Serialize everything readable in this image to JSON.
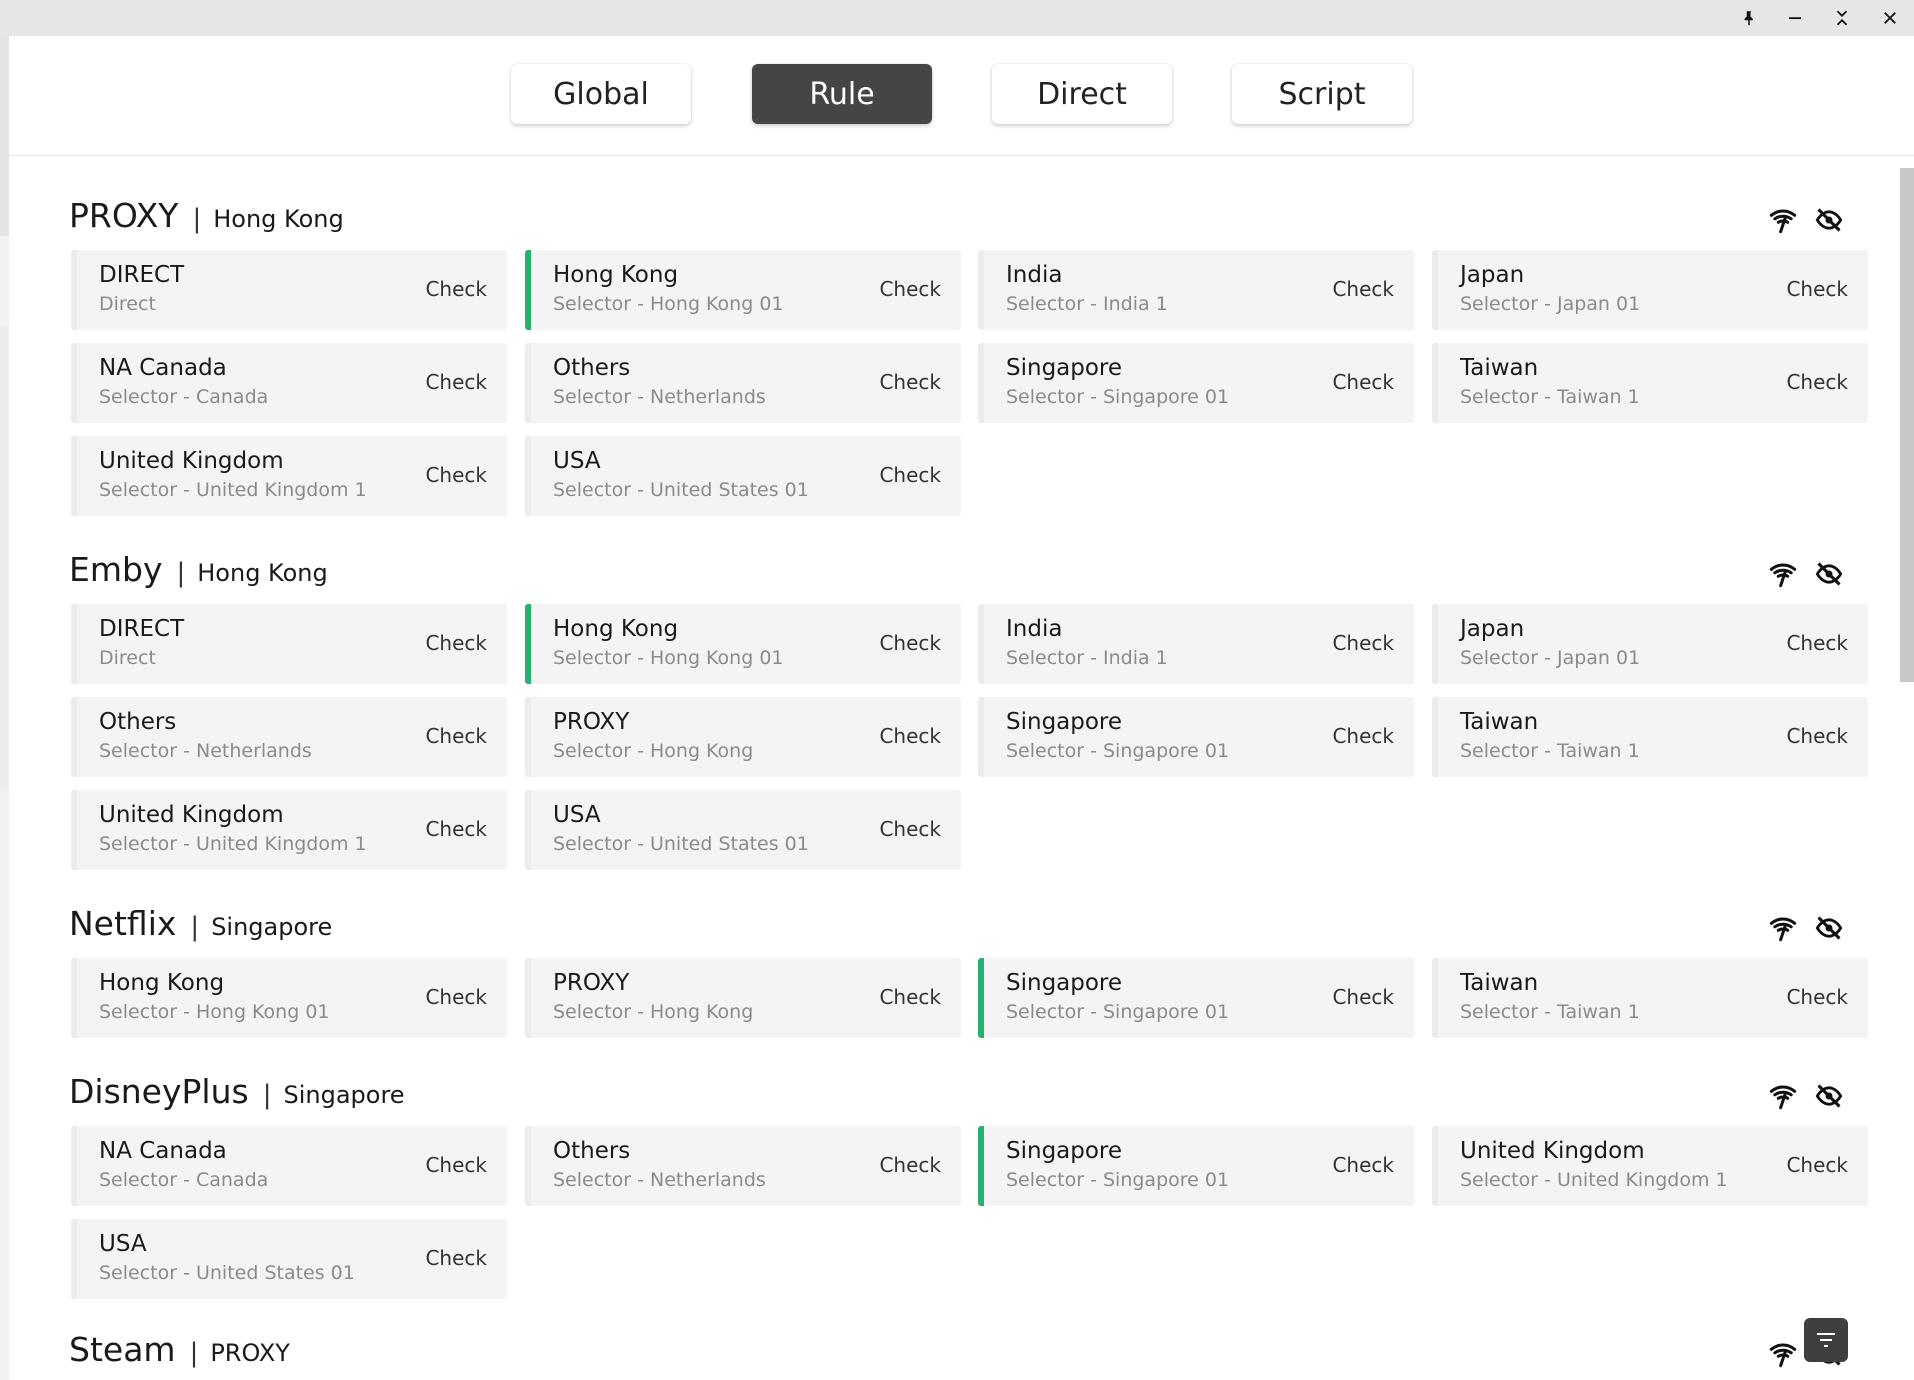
{
  "modes": [
    "Global",
    "Rule",
    "Direct",
    "Script"
  ],
  "active_mode": "Rule",
  "window_controls": [
    "pin-icon",
    "minimize-icon",
    "collapse-icon",
    "close-icon"
  ],
  "accent_color": "#27b06e",
  "check_label": "Check",
  "groups": [
    {
      "name": "PROXY",
      "now": "Hong Kong",
      "proxies": [
        {
          "name": "DIRECT",
          "sub": "Direct",
          "selected": false
        },
        {
          "name": "Hong Kong",
          "sub": "Selector - Hong Kong 01",
          "selected": true
        },
        {
          "name": "India",
          "sub": "Selector - India 1",
          "selected": false
        },
        {
          "name": "Japan",
          "sub": "Selector - Japan 01",
          "selected": false
        },
        {
          "name": "NA Canada",
          "sub": "Selector - Canada",
          "selected": false
        },
        {
          "name": "Others",
          "sub": "Selector - Netherlands",
          "selected": false
        },
        {
          "name": "Singapore",
          "sub": "Selector - Singapore 01",
          "selected": false
        },
        {
          "name": "Taiwan",
          "sub": "Selector - Taiwan 1",
          "selected": false
        },
        {
          "name": "United Kingdom",
          "sub": "Selector - United Kingdom 1",
          "selected": false
        },
        {
          "name": "USA",
          "sub": "Selector - United States 01",
          "selected": false
        }
      ]
    },
    {
      "name": "Emby",
      "now": "Hong Kong",
      "proxies": [
        {
          "name": "DIRECT",
          "sub": "Direct",
          "selected": false
        },
        {
          "name": "Hong Kong",
          "sub": "Selector - Hong Kong 01",
          "selected": true
        },
        {
          "name": "India",
          "sub": "Selector - India 1",
          "selected": false
        },
        {
          "name": "Japan",
          "sub": "Selector - Japan 01",
          "selected": false
        },
        {
          "name": "Others",
          "sub": "Selector - Netherlands",
          "selected": false
        },
        {
          "name": "PROXY",
          "sub": "Selector - Hong Kong",
          "selected": false
        },
        {
          "name": "Singapore",
          "sub": "Selector - Singapore 01",
          "selected": false
        },
        {
          "name": "Taiwan",
          "sub": "Selector - Taiwan 1",
          "selected": false
        },
        {
          "name": "United Kingdom",
          "sub": "Selector - United Kingdom 1",
          "selected": false
        },
        {
          "name": "USA",
          "sub": "Selector - United States 01",
          "selected": false
        }
      ]
    },
    {
      "name": "Netflix",
      "now": "Singapore",
      "proxies": [
        {
          "name": "Hong Kong",
          "sub": "Selector - Hong Kong 01",
          "selected": false
        },
        {
          "name": "PROXY",
          "sub": "Selector - Hong Kong",
          "selected": false
        },
        {
          "name": "Singapore",
          "sub": "Selector - Singapore 01",
          "selected": true
        },
        {
          "name": "Taiwan",
          "sub": "Selector - Taiwan 1",
          "selected": false
        }
      ]
    },
    {
      "name": "DisneyPlus",
      "now": "Singapore",
      "proxies": [
        {
          "name": "NA Canada",
          "sub": "Selector - Canada",
          "selected": false
        },
        {
          "name": "Others",
          "sub": "Selector - Netherlands",
          "selected": false
        },
        {
          "name": "Singapore",
          "sub": "Selector - Singapore 01",
          "selected": true
        },
        {
          "name": "United Kingdom",
          "sub": "Selector - United Kingdom 1",
          "selected": false
        },
        {
          "name": "USA",
          "sub": "Selector - United States 01",
          "selected": false
        }
      ]
    },
    {
      "name": "Steam",
      "now": "PROXY",
      "proxies": []
    }
  ],
  "group_actions": [
    "latency-test-icon",
    "hide-icon"
  ],
  "fab_icon": "filter-icon"
}
